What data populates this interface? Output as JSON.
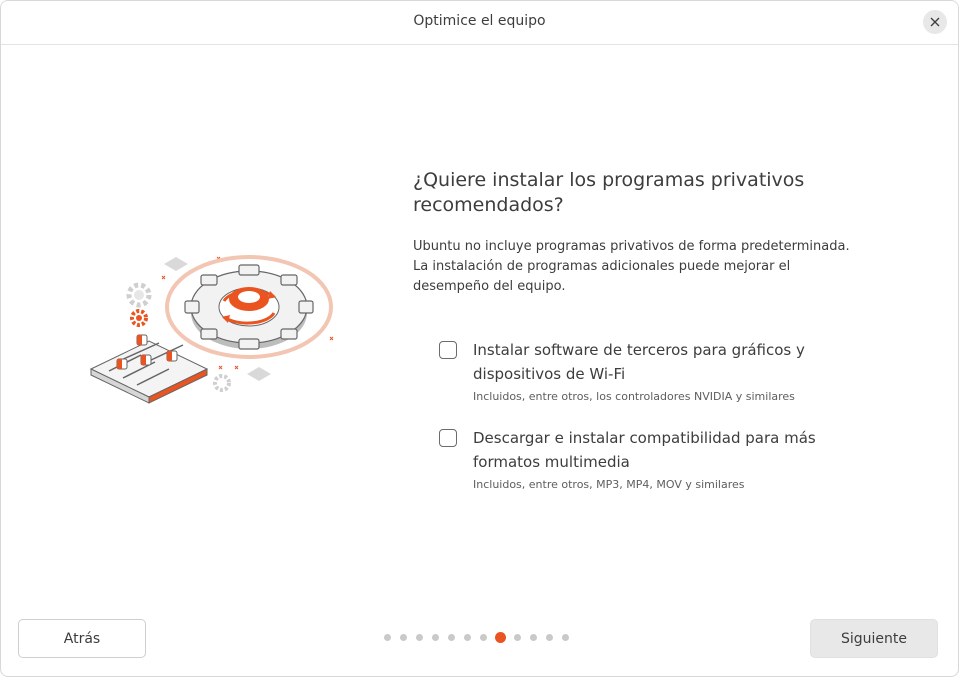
{
  "window": {
    "title": "Optimice el equipo"
  },
  "main": {
    "heading": "¿Quiere instalar los programas privativos recomendados?",
    "description": "Ubuntu no incluye programas privativos de forma predeterminada. La instalación de programas adicionales puede mejorar el desempeño del equipo.",
    "options": [
      {
        "label": "Instalar software de terceros para gráficos y dispositivos de Wi-Fi",
        "sublabel": "Incluidos, entre otros, los controladores NVIDIA y similares",
        "checked": false
      },
      {
        "label": "Descargar e instalar compatibilidad para más formatos multimedia",
        "sublabel": "Incluidos, entre otros, MP3, MP4, MOV y similares",
        "checked": false
      }
    ]
  },
  "footer": {
    "back_label": "Atrás",
    "next_label": "Siguiente",
    "progress": {
      "total_steps": 12,
      "current_step": 8
    }
  },
  "colors": {
    "accent": "#e95420",
    "button_bg": "#e8e8e8",
    "dot_inactive": "#c9c9c9"
  },
  "icons": {
    "close": "close-icon",
    "illustration": "gear-settings-illustration"
  }
}
